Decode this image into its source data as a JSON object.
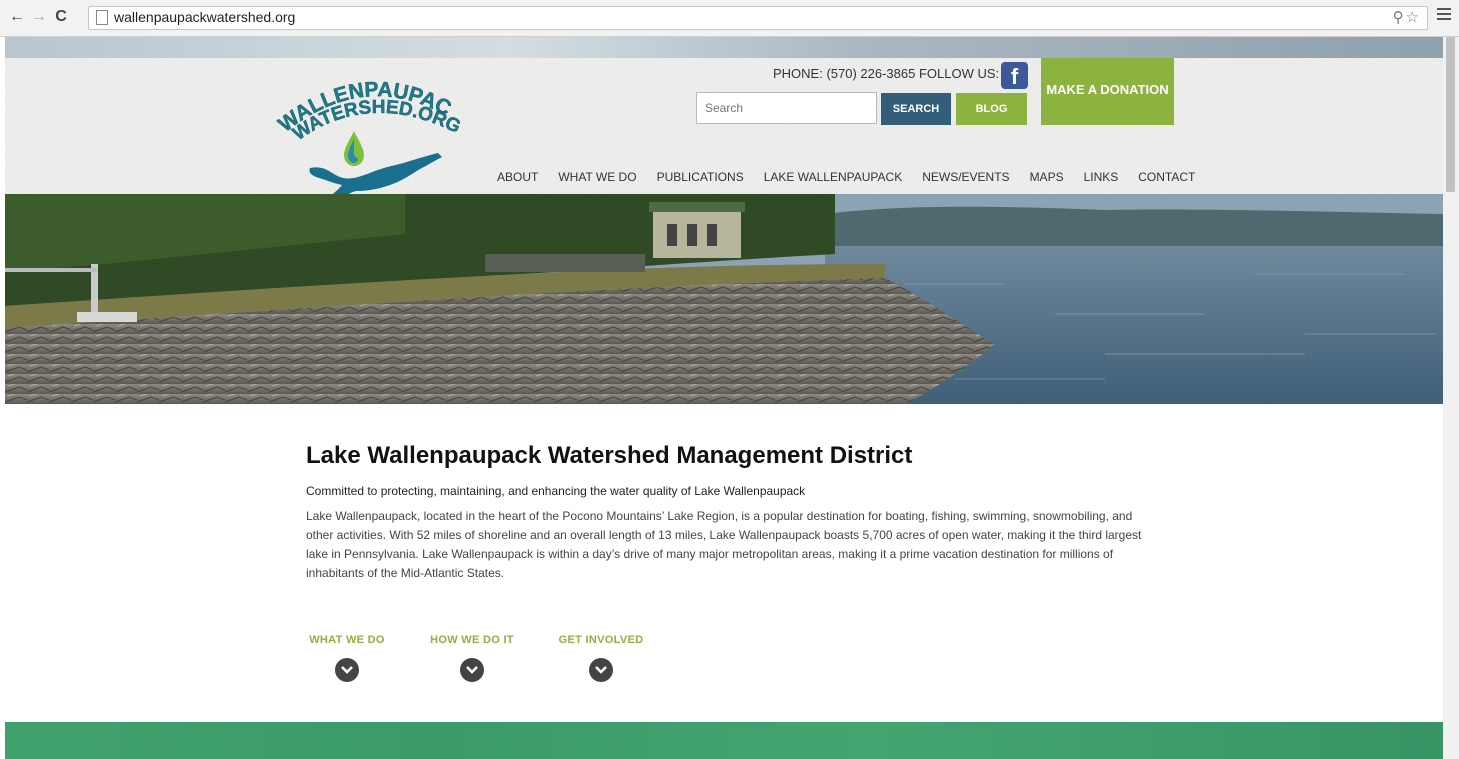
{
  "browser": {
    "url": "wallenpaupackwatershed.org",
    "back_icon": "arrow-left-icon",
    "forward_icon": "arrow-right-icon",
    "reload_icon": "reload-icon"
  },
  "header": {
    "logo_text_line1": "WALLENPAUPACK",
    "logo_text_line2": "WATERSHED.ORG",
    "phone": "PHONE: (570) 226-3865",
    "follow": "FOLLOW US:",
    "facebook_icon": "facebook-icon",
    "donate_label": "MAKE A DONATION",
    "search_placeholder": "Search",
    "search_button": "SEARCH",
    "blog_button": "BLOG",
    "nav": [
      "ABOUT",
      "WHAT WE DO",
      "PUBLICATIONS",
      "LAKE WALLENPAUPACK",
      "NEWS/EVENTS",
      "MAPS",
      "LINKS",
      "CONTACT"
    ]
  },
  "main": {
    "title": "Lake Wallenpaupack Watershed Management District",
    "tagline": "Committed to protecting, maintaining, and enhancing the water quality of Lake Wallenpaupack",
    "body": "Lake Wallenpaupack, located in the heart of the Pocono Mountains’ Lake Region, is a popular destination for boating, fishing, swimming, snowmobiling, and other activities. With 52 miles of shoreline and an overall length of 13 miles, Lake Wallenpaupack boasts 5,700 acres of open water, making it the third largest lake in Pennsylvania. Lake Wallenpaupack is within a day’s drive of many major metropolitan areas, making it a prime vacation destination for millions of inhabitants of the Mid-Atlantic States."
  },
  "sections": [
    {
      "label": "WHAT WE DO",
      "icon": "chevron-down-icon"
    },
    {
      "label": "HOW WE DO IT",
      "icon": "chevron-down-icon"
    },
    {
      "label": "GET INVOLVED",
      "icon": "chevron-down-icon"
    }
  ],
  "colors": {
    "accent_green": "#8cb240",
    "search_blue": "#335e7a",
    "facebook_blue": "#3b5998",
    "band_green": "#41a16d"
  }
}
